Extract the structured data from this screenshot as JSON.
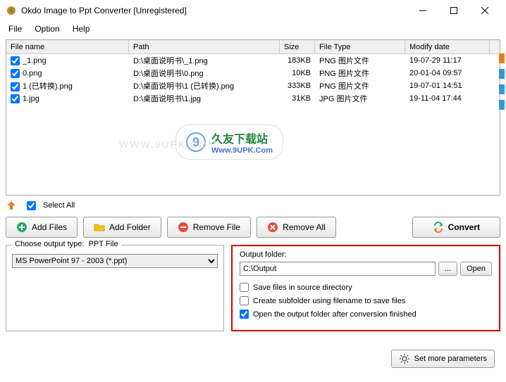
{
  "window": {
    "title": "Okdo Image to Ppt Converter [Unregistered]"
  },
  "menu": {
    "file": "File",
    "option": "Option",
    "help": "Help"
  },
  "table": {
    "headers": {
      "name": "File name",
      "path": "Path",
      "size": "Size",
      "type": "File Type",
      "date": "Modify date"
    },
    "rows": [
      {
        "name": "_1.png",
        "path": "D:\\桌面说明书\\_1.png",
        "size": "183KB",
        "type": "PNG 图片文件",
        "date": "19-07-29 11:17"
      },
      {
        "name": "0.png",
        "path": "D:\\桌面说明书\\0.png",
        "size": "10KB",
        "type": "PNG 图片文件",
        "date": "20-01-04 09:57"
      },
      {
        "name": "1 (已转换).png",
        "path": "D:\\桌面说明书\\1 (已转换).png",
        "size": "333KB",
        "type": "PNG 图片文件",
        "date": "19-07-01 14:51"
      },
      {
        "name": "1.jpg",
        "path": "D:\\桌面说明书\\1.jpg",
        "size": "31KB",
        "type": "JPG 图片文件",
        "date": "19-11-04 17:44"
      }
    ]
  },
  "watermark": {
    "bg": "WWW.9UPK.COM",
    "main": "久友下载站",
    "sub": "Www.9UPK.Com"
  },
  "toolbar": {
    "select_all": "Select All",
    "add_files": "Add Files",
    "add_folder": "Add Folder",
    "remove_file": "Remove File",
    "remove_all": "Remove All",
    "convert": "Convert"
  },
  "output_type": {
    "label": "Choose output type:",
    "sublabel": "PPT File",
    "selected": "MS PowerPoint 97 - 2003 (*.ppt)"
  },
  "output_folder": {
    "label": "Output folder:",
    "path": "C:\\Output",
    "browse": "...",
    "open": "Open",
    "check_source": "Save files in source directory",
    "check_subfolder": "Create subfolder using filename to save files",
    "check_open_after": "Open the output folder after conversion finished"
  },
  "set_more": "Set more parameters"
}
